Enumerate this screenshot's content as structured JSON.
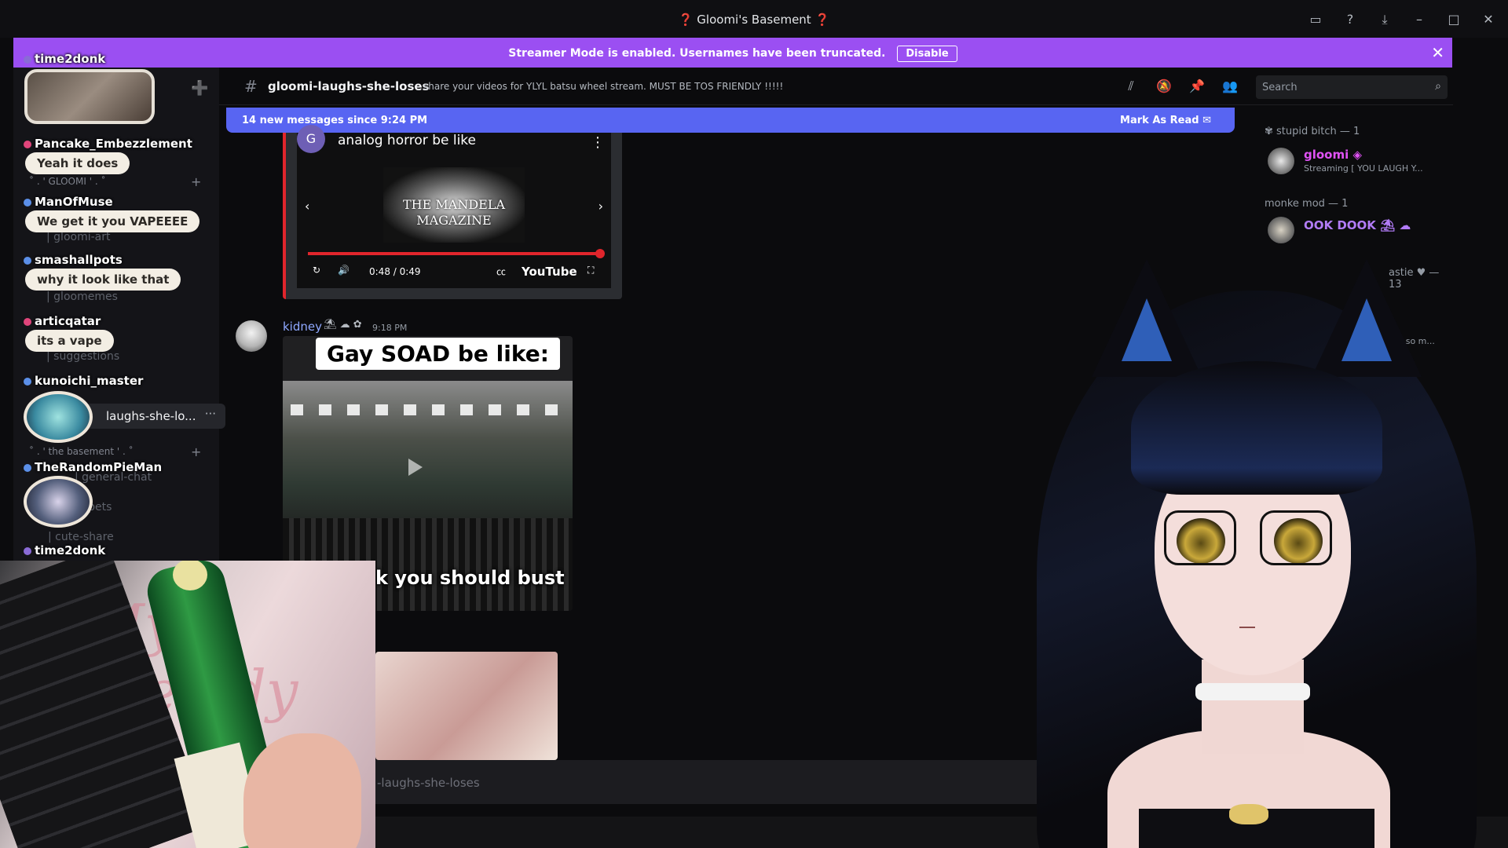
{
  "window": {
    "title": "❓ Gloomi's Basement ❓"
  },
  "banner": {
    "message": "Streamer Mode is enabled. Usernames have been truncated.",
    "disable_label": "Disable"
  },
  "sidebar": {
    "categories": [
      "˚ . ' GLOOMI ' . ˚",
      "˚ . ' the basement ' . ˚"
    ],
    "channels": [
      "| gloomi-art",
      "| gloomemes",
      "| suggestions",
      "| general-chat",
      "| pets",
      "| cute-share"
    ],
    "active_channel": "laughs-she-lo..."
  },
  "stream_chat": {
    "messages": [
      {
        "user": "time2donk",
        "text": "",
        "badge_color": "#8a6bd6"
      },
      {
        "user": "Pancake_Embezzlement",
        "text": "Yeah it does",
        "badge_color": "#e0457b"
      },
      {
        "user": "ManOfMuse",
        "text": "We get it you VAPEEEE",
        "badge_color": "#5b8fe8"
      },
      {
        "user": "smashallpots",
        "text": "why it look like that",
        "badge_color": "#5b8fe8"
      },
      {
        "user": "articqatar",
        "text": "its a vape",
        "badge_color": "#e0457b"
      },
      {
        "user": "kunoichi_master",
        "text": "",
        "badge_color": "#5b8fe8"
      },
      {
        "user": "TheRandomPieMan",
        "text": "",
        "badge_color": "#5b8fe8"
      },
      {
        "user": "time2donk",
        "text": "",
        "badge_color": "#8a6bd6"
      }
    ]
  },
  "header": {
    "channel_name": "gloomi-laughs-she-loses",
    "topic": "share your videos for YLYL batsu wheel stream. MUST BE TOS FRIENDLY !!!!!",
    "search_placeholder": "Search"
  },
  "new_messages": {
    "text": "14 new messages since 9:24 PM",
    "mark_label": "Mark As Read"
  },
  "youtube": {
    "video_title": "analog horror be like",
    "channel_initial": "G",
    "overlay_title": "THE MANDELA MAGAZINE",
    "time": "0:48 / 0:49",
    "progress": 0.98,
    "brand": "YouTube"
  },
  "message": {
    "author": "kidney",
    "time": "9:18 PM",
    "meme_caption": "Gay SOAD be like:",
    "meme_subtitle": "k you should bust"
  },
  "composer": {
    "placeholder": "-laughs-she-loses"
  },
  "members": {
    "groups": [
      {
        "title": "stupid bitch — 1",
        "name": "gloomi",
        "status": "Streaming [ YOU LAUGH Y...",
        "color": "#e052f5"
      },
      {
        "title": "monke mod — 1",
        "name": "OOK DOOK",
        "status": "",
        "color": "#b27cf7"
      },
      {
        "title": "astie ♥ — 13",
        "name": "",
        "status": "you so m...",
        "color": "#9b59d0"
      }
    ]
  },
  "colors": {
    "accent": "#9b4ff2",
    "blurple": "#5865f2",
    "youtube_red": "#e0252c"
  }
}
